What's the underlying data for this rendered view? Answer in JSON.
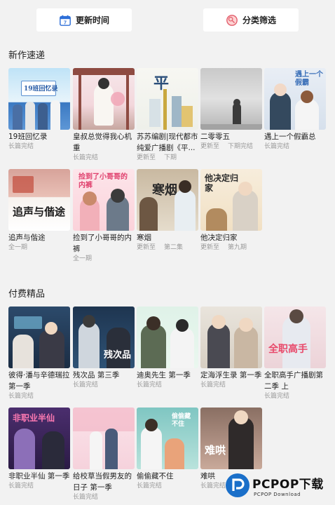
{
  "topbar": {
    "update_time_label": "更新时间",
    "filter_label": "分类筛选",
    "calendar_number": "7"
  },
  "sections": {
    "new_title": "新作速递",
    "paid_title": "付费精品"
  },
  "new_works": [
    {
      "title": "19班回忆录",
      "meta": [
        "长篇完结"
      ],
      "cover_text": "19班回忆录"
    },
    {
      "title": "皇叔总觉得我心机重",
      "meta": [
        "长篇完结"
      ],
      "cover_text": ""
    },
    {
      "title": "苏苏编剧|现代都市纯爱广播剧《平...",
      "meta": [
        "更新至",
        "下期"
      ],
      "cover_text": "平"
    },
    {
      "title": "二零零五",
      "meta": [
        "更新至",
        "下期完结"
      ],
      "cover_text": ""
    },
    {
      "title": "遇上一个假霸总",
      "meta": [
        "长篇完结"
      ],
      "cover_text": "遇上一个假霸"
    },
    {
      "title": "追声与偕途",
      "meta": [
        "全一期"
      ],
      "cover_text": "追声与偕途"
    },
    {
      "title": "捡到了小哥哥的内裤",
      "meta": [
        "全一期"
      ],
      "cover_text": "捡到了小哥哥的内裤"
    },
    {
      "title": "寒烟",
      "meta": [
        "更新至",
        "第二集"
      ],
      "cover_text": "寒烟"
    },
    {
      "title": "他决定归家",
      "meta": [
        "更新至",
        "第九期"
      ],
      "cover_text": "他决定归家"
    }
  ],
  "paid_works": [
    {
      "title": "彼得·潘与辛德瑞拉第一季",
      "meta": [
        "长篇完结"
      ],
      "cover_text": ""
    },
    {
      "title": "残次品 第三季",
      "meta": [
        "长篇完结"
      ],
      "cover_text": "残次品"
    },
    {
      "title": "迪奥先生 第一季",
      "meta": [
        "长篇完结"
      ],
      "cover_text": ""
    },
    {
      "title": "定海浮生录 第一季",
      "meta": [
        "长篇完结"
      ],
      "cover_text": ""
    },
    {
      "title": "全职高手广播剧第二季 上",
      "meta": [
        "长篇完结"
      ],
      "cover_text": "全职高手"
    },
    {
      "title": "非职业半仙 第一季",
      "meta": [
        "长篇完结"
      ],
      "cover_text": "非职业半仙"
    },
    {
      "title": "给校草当假男友的日子 第一季",
      "meta": [
        "长篇完结"
      ],
      "cover_text": ""
    },
    {
      "title": "偷偷藏不住",
      "meta": [
        "长篇完结"
      ],
      "cover_text": "偷偷藏不住"
    },
    {
      "title": "难哄",
      "meta": [
        "长篇完结"
      ],
      "cover_text": "难哄"
    }
  ],
  "watermark": {
    "main": "PCPOP下载",
    "sub": "PCPOP Download"
  },
  "colors": {
    "background": "#f2f2f2",
    "card_meta": "#9a9a9a",
    "logo_blue": "#1a6fc9"
  }
}
